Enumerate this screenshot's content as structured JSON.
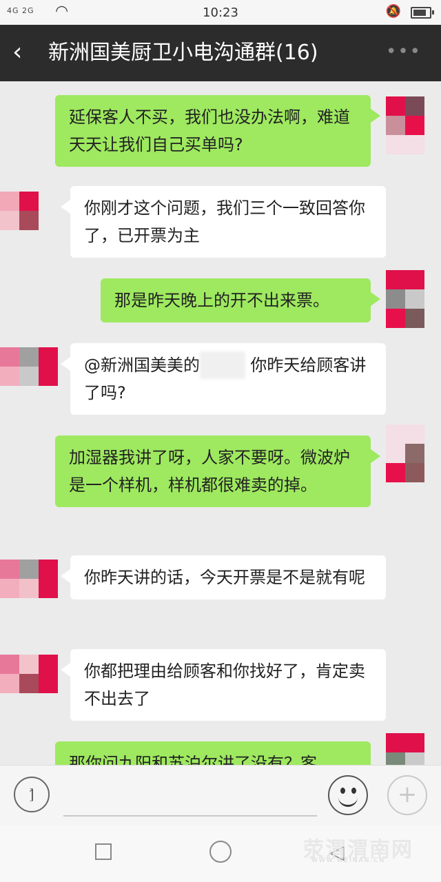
{
  "status_bar": {
    "network": "4G 2G",
    "time": "10:23"
  },
  "header": {
    "back_icon": "chevron-left-icon",
    "title": "新洲国美厨卫小电沟通群(16)",
    "more_icon": "more-dots-icon"
  },
  "messages": [
    {
      "side": "out",
      "text": "延保客人不买，我们也没办法啊，难道天天让我们自己买单吗?"
    },
    {
      "side": "in",
      "text": "你刚才这个问题，我们三个一致回答你了，已开票为主"
    },
    {
      "side": "out",
      "text": "那是昨天晚上的开不出来票。"
    },
    {
      "side": "in",
      "prefix": "@新洲国美美的",
      "text": "你昨天给顾客讲了吗?"
    },
    {
      "side": "out",
      "text": "加湿器我讲了呀，人家不要呀。微波炉是一个样机，样机都很难卖的掉。"
    },
    {
      "side": "in",
      "text": "你昨天讲的话，今天开票是不是就有呢"
    },
    {
      "side": "in",
      "text": "你都把理由给顾客和你找好了，肯定卖不出去了"
    },
    {
      "side": "out",
      "text": "那你问九阳和苏泊尔讲了没有？客"
    }
  ],
  "input_bar": {
    "voice_icon": "voice-icon",
    "text_value": "",
    "emoji_icon": "emoji-icon",
    "plus_icon": "plus-icon"
  },
  "nav_bar": {
    "recent_icon": "square-icon",
    "home_icon": "circle-icon",
    "back_icon": "triangle-back-icon"
  },
  "watermark": {
    "text": "荥渭渭南网",
    "sub": "WWW.WEINAN.CN"
  },
  "colors": {
    "outgoing_bubble": "#9ee95f",
    "incoming_bubble": "#ffffff",
    "header_bg": "#2c2c2c",
    "chat_bg": "#ebebeb"
  }
}
